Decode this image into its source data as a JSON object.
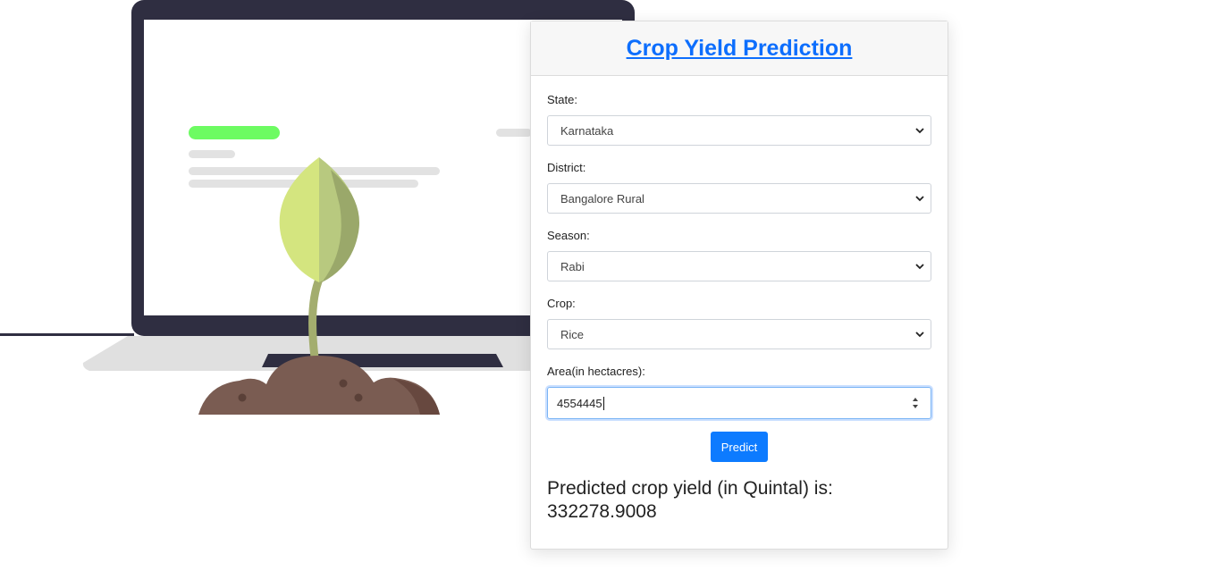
{
  "card": {
    "title": "Crop Yield Prediction"
  },
  "form": {
    "state": {
      "label": "State:",
      "value": "Karnataka"
    },
    "district": {
      "label": "District:",
      "value": "Bangalore Rural"
    },
    "season": {
      "label": "Season:",
      "value": "Rabi"
    },
    "crop": {
      "label": "Crop:",
      "value": "Rice"
    },
    "area": {
      "label": "Area(in hectacres):",
      "value": "4554445"
    },
    "predict_label": "Predict"
  },
  "result": {
    "text": "Predicted crop yield (in Quintal) is:",
    "value": "332278.9008"
  },
  "colors": {
    "accent": "#0d7bff",
    "laptop": "#2f2e41",
    "soil": "#7a5c52",
    "leaf_light": "#d4e57f",
    "leaf_dark": "#9aa86a",
    "stem": "#a3ad6e",
    "highlight_bar": "#6dfb62"
  }
}
